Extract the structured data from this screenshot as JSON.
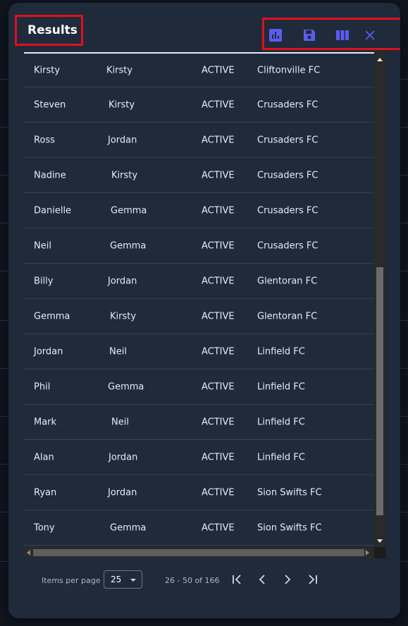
{
  "dialog": {
    "title": "Results",
    "toolbar": {
      "icons": [
        "bar-chart-icon",
        "save-icon",
        "columns-icon",
        "close-icon"
      ],
      "accent_color": "#5b5cf0"
    }
  },
  "table": {
    "rows": [
      [
        "Kirsty",
        "Kirsty",
        "ACTIVE",
        "Cliftonville FC"
      ],
      [
        "Steven",
        "Kirsty",
        "ACTIVE",
        "Crusaders FC"
      ],
      [
        "Ross",
        "Jordan",
        "ACTIVE",
        "Crusaders FC"
      ],
      [
        "Nadine",
        "Kirsty",
        "ACTIVE",
        "Crusaders FC"
      ],
      [
        "Danielle",
        "Gemma",
        "ACTIVE",
        "Crusaders FC"
      ],
      [
        "Neil",
        "Gemma",
        "ACTIVE",
        "Crusaders FC"
      ],
      [
        "Billy",
        "Jordan",
        "ACTIVE",
        "Glentoran FC"
      ],
      [
        "Gemma",
        "Kirsty",
        "ACTIVE",
        "Glentoran FC"
      ],
      [
        "Jordan",
        "Neil",
        "ACTIVE",
        "Linfield FC"
      ],
      [
        "Phil",
        "Gemma",
        "ACTIVE",
        "Linfield FC"
      ],
      [
        "Mark",
        "Neil",
        "ACTIVE",
        "Linfield FC"
      ],
      [
        "Alan",
        "Jordan",
        "ACTIVE",
        "Linfield FC"
      ],
      [
        "Ryan",
        "Jordan",
        "ACTIVE",
        "Sion Swifts FC"
      ],
      [
        "Tony",
        "Gemma",
        "ACTIVE",
        "Sion Swifts FC"
      ]
    ]
  },
  "paginator": {
    "items_per_page_label": "Items per page",
    "items_per_page_value": "25",
    "range_label": "26 - 50 of 166"
  },
  "colors": {
    "dialog_bg": "#1f2a3b",
    "highlight_border": "#e0101c",
    "text": "#e9ecf2"
  }
}
